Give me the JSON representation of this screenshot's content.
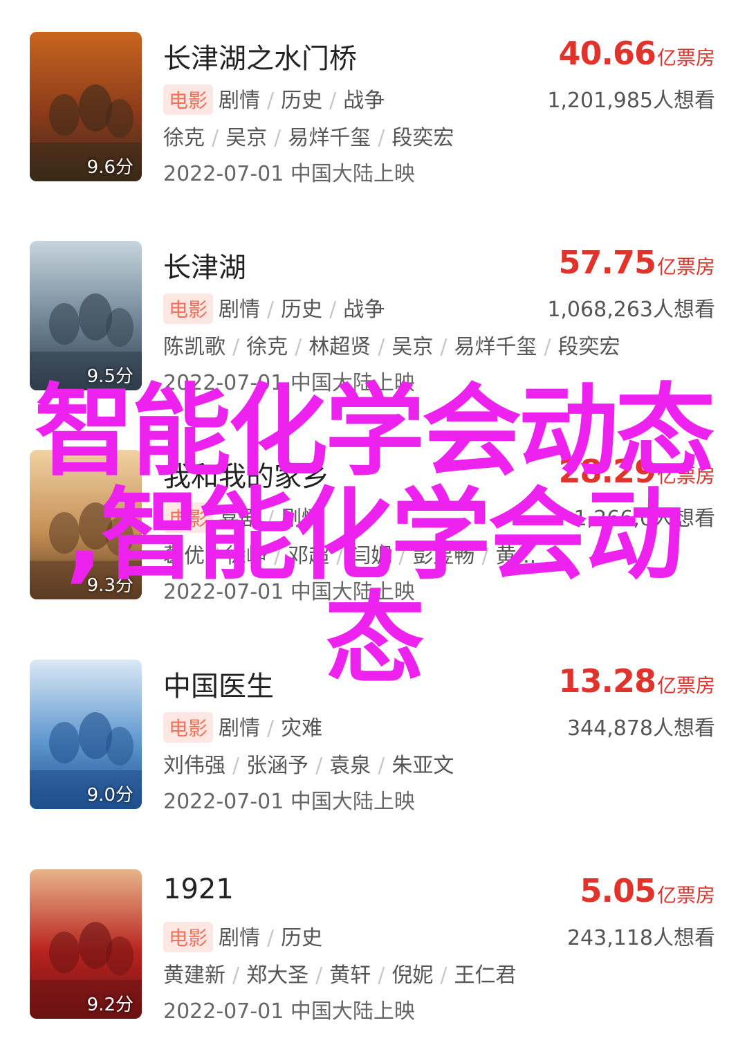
{
  "unit_box": "亿票房",
  "unit_want": "人想看",
  "badge": "电影",
  "separator": "/",
  "colors": {
    "box_office": "#e0332b",
    "badge_bg": "#fde7e2",
    "badge_text": "#f0705a",
    "watermark": "#ee22ee"
  },
  "movies": [
    {
      "title": "长津湖之水门桥",
      "score": "9.6分",
      "box": "40.66",
      "want": "1,201,985",
      "genres": [
        "剧情",
        "历史",
        "战争"
      ],
      "cast": [
        "徐克",
        "吴京",
        "易烊千玺",
        "段奕宏"
      ],
      "release": "2022-07-01 中国大陆上映",
      "poster_icon": "poster-war-fire",
      "poster_colors": [
        "#3a2a1a",
        "#8a3a1a",
        "#c8651e"
      ]
    },
    {
      "title": "长津湖",
      "score": "9.5分",
      "box": "57.75",
      "want": "1,068,263",
      "genres": [
        "剧情",
        "历史",
        "战争"
      ],
      "cast": [
        "陈凯歌",
        "徐克",
        "林超贤",
        "吴京",
        "易烊千玺",
        "段奕宏"
      ],
      "release": "2022-07-01 中国大陆上映",
      "poster_icon": "poster-snow-soldiers",
      "poster_colors": [
        "#2f3d4a",
        "#6d8394",
        "#c7d5dd"
      ]
    },
    {
      "title": "我和我的家乡",
      "score": "9.3分",
      "box": "28.29",
      "want": "1,266,0",
      "genres": [
        "喜剧",
        "剧情"
      ],
      "cast": [
        "葛优",
        "徐峥",
        "邓超",
        "闫妮",
        "彭昱畅",
        "黄..."
      ],
      "release": "2022-07-01 中国大陆上映",
      "poster_icon": "poster-hometown-faces",
      "poster_colors": [
        "#5a3a22",
        "#c58f55",
        "#f0d2a2"
      ]
    },
    {
      "title": "中国医生",
      "score": "9.0分",
      "box": "13.28",
      "want": "344,878",
      "genres": [
        "剧情",
        "灾难"
      ],
      "cast": [
        "刘伟强",
        "张涵予",
        "袁泉",
        "朱亚文"
      ],
      "release": "2022-07-01 中国大陆上映",
      "poster_icon": "poster-doctors-running",
      "poster_colors": [
        "#1e4f8c",
        "#5f97cf",
        "#dbe9f6"
      ]
    },
    {
      "title": "1921",
      "score": "9.2分",
      "box": "5.05",
      "want": "243,118",
      "genres": [
        "剧情",
        "历史"
      ],
      "cast": [
        "黄建新",
        "郑大圣",
        "黄轩",
        "倪妮",
        "王仁君"
      ],
      "release": "2022-07-01 中国大陆上映",
      "poster_icon": "poster-1921-red",
      "poster_colors": [
        "#6b1212",
        "#b8231f",
        "#e8b58a"
      ]
    }
  ],
  "watermark": {
    "line1": "智能化学会动态",
    "line2": ",智能化学会动",
    "line3": "态"
  }
}
